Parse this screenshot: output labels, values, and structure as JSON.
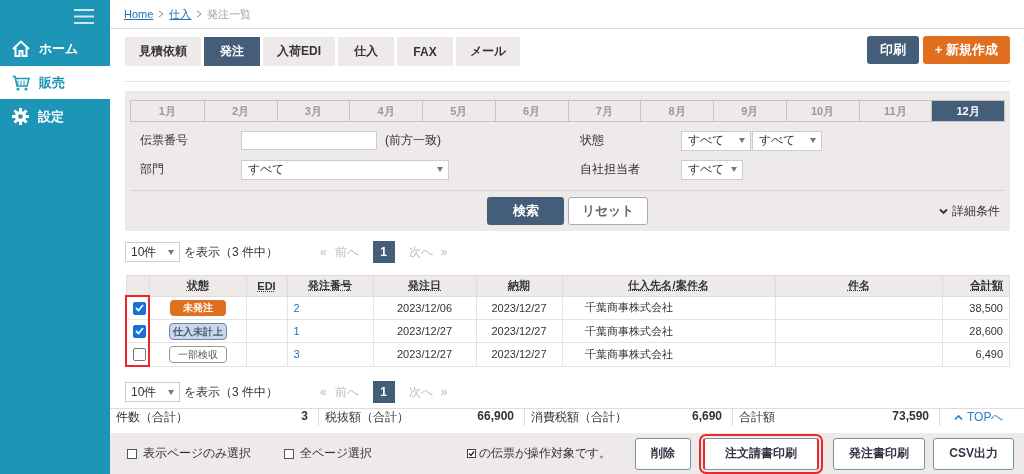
{
  "sidebar": {
    "items": [
      {
        "label": "ホーム",
        "selected": false
      },
      {
        "label": "販売",
        "selected": true
      },
      {
        "label": "設定",
        "selected": false
      }
    ]
  },
  "breadcrumb": [
    {
      "label": "Home",
      "link": true
    },
    {
      "label": "仕入",
      "link": true
    },
    {
      "label": "発注一覧",
      "link": false
    }
  ],
  "tabs": [
    {
      "label": "見積依頼",
      "selected": false
    },
    {
      "label": "発注",
      "selected": true
    },
    {
      "label": "入荷EDI",
      "selected": false
    },
    {
      "label": "仕入",
      "selected": false
    },
    {
      "label": "FAX",
      "selected": false
    },
    {
      "label": "メール",
      "selected": false
    }
  ],
  "actions": [
    {
      "label": "印刷",
      "kind": "print"
    },
    {
      "label": "+ 新規作成",
      "kind": "create"
    }
  ],
  "months": [
    {
      "label": "1月",
      "selected": false
    },
    {
      "label": "2月",
      "selected": false
    },
    {
      "label": "3月",
      "selected": false
    },
    {
      "label": "4月",
      "selected": false
    },
    {
      "label": "5月",
      "selected": false
    },
    {
      "label": "6月",
      "selected": false
    },
    {
      "label": "7月",
      "selected": false
    },
    {
      "label": "8月",
      "selected": false
    },
    {
      "label": "9月",
      "selected": false
    },
    {
      "label": "10月",
      "selected": false
    },
    {
      "label": "11月",
      "selected": false
    },
    {
      "label": "12月",
      "selected": true
    }
  ],
  "filters": {
    "slip": {
      "label": "伝票番号",
      "note": "(前方一致)"
    },
    "status": {
      "label": "状態",
      "selects": [
        "すべて",
        "すべて"
      ]
    },
    "dept": {
      "label": "部門",
      "select": "すべて"
    },
    "staff": {
      "label": "自社担当者",
      "select": "すべて"
    }
  },
  "search_buttons": [
    {
      "label": "検索",
      "kind": "primary"
    },
    {
      "label": "リセット",
      "kind": "secondary"
    }
  ],
  "details_toggle": "詳細条件",
  "pager_top": {
    "page_size": "10件",
    "summary": "を表示（3 件中）",
    "first": "«",
    "prev": "前へ",
    "pages": [
      {
        "label": "1",
        "selected": true
      }
    ],
    "next": "次へ",
    "last": "»"
  },
  "table": {
    "checkbox_highlighted": true,
    "columns": [
      "状態",
      "EDI",
      "発注番号",
      "発注日",
      "納期",
      "仕入先名/案件名",
      "件名",
      "合計額"
    ],
    "rows": [
      {
        "checked": true,
        "status": {
          "label": "未発注",
          "kind": "unordered"
        },
        "order_no": "2",
        "order_date": "2023/12/06",
        "due": "2023/12/27",
        "supplier": "千葉商事株式会社",
        "total": "38,500"
      },
      {
        "checked": true,
        "status": {
          "label": "仕入未計上",
          "kind": "unposted"
        },
        "order_no": "1",
        "order_date": "2023/12/27",
        "due": "2023/12/27",
        "supplier": "千葉商事株式会社",
        "total": "28,600"
      },
      {
        "checked": false,
        "status": {
          "label": "一部検収",
          "kind": "partial"
        },
        "order_no": "3",
        "order_date": "2023/12/27",
        "due": "2023/12/27",
        "supplier": "千葉商事株式会社",
        "total": "6,490"
      }
    ]
  },
  "pager_bottom": {
    "page_size": "10件",
    "summary": "を表示（3 件中）",
    "first": "«",
    "prev": "前へ",
    "pages": [
      {
        "label": "1",
        "selected": true
      }
    ],
    "next": "次へ",
    "last": "»"
  },
  "totals": [
    {
      "label": "件数（合計）",
      "value": "3"
    },
    {
      "label": "税抜額（合計）",
      "value": "66,900"
    },
    {
      "label": "消費税額（合計）",
      "value": "6,690"
    },
    {
      "label": "合計額",
      "value": "73,590"
    }
  ],
  "top_link": "TOPへ",
  "footer": {
    "selections": [
      {
        "label": "表示ページのみ選択",
        "checked": false
      },
      {
        "label": "全ページ選択",
        "checked": false
      }
    ],
    "note": "の伝票が操作対象です。",
    "buttons": [
      {
        "label": "削除",
        "highlighted": false
      },
      {
        "label": "注文請書印刷",
        "highlighted": true
      },
      {
        "label": "発注書印刷",
        "highlighted": false
      },
      {
        "label": "CSV出力",
        "highlighted": false
      }
    ]
  }
}
